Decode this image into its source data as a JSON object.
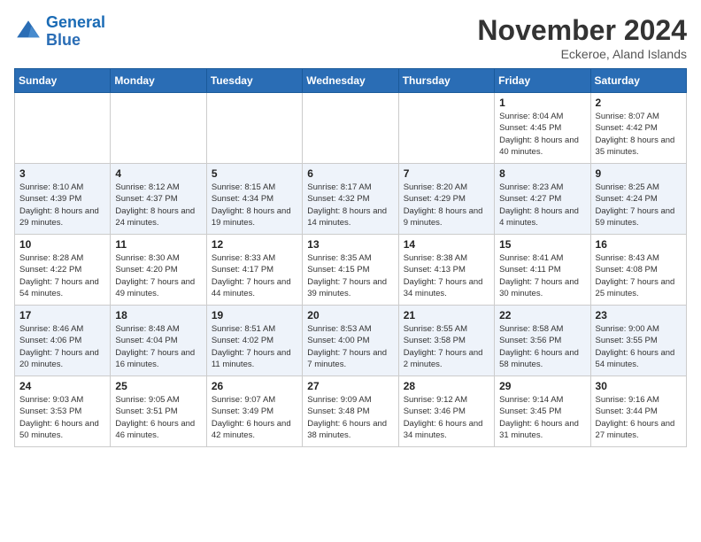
{
  "header": {
    "logo_line1": "General",
    "logo_line2": "Blue",
    "month_title": "November 2024",
    "subtitle": "Eckeroe, Aland Islands"
  },
  "weekdays": [
    "Sunday",
    "Monday",
    "Tuesday",
    "Wednesday",
    "Thursday",
    "Friday",
    "Saturday"
  ],
  "weeks": [
    [
      {
        "day": "",
        "info": ""
      },
      {
        "day": "",
        "info": ""
      },
      {
        "day": "",
        "info": ""
      },
      {
        "day": "",
        "info": ""
      },
      {
        "day": "",
        "info": ""
      },
      {
        "day": "1",
        "info": "Sunrise: 8:04 AM\nSunset: 4:45 PM\nDaylight: 8 hours and 40 minutes."
      },
      {
        "day": "2",
        "info": "Sunrise: 8:07 AM\nSunset: 4:42 PM\nDaylight: 8 hours and 35 minutes."
      }
    ],
    [
      {
        "day": "3",
        "info": "Sunrise: 8:10 AM\nSunset: 4:39 PM\nDaylight: 8 hours and 29 minutes."
      },
      {
        "day": "4",
        "info": "Sunrise: 8:12 AM\nSunset: 4:37 PM\nDaylight: 8 hours and 24 minutes."
      },
      {
        "day": "5",
        "info": "Sunrise: 8:15 AM\nSunset: 4:34 PM\nDaylight: 8 hours and 19 minutes."
      },
      {
        "day": "6",
        "info": "Sunrise: 8:17 AM\nSunset: 4:32 PM\nDaylight: 8 hours and 14 minutes."
      },
      {
        "day": "7",
        "info": "Sunrise: 8:20 AM\nSunset: 4:29 PM\nDaylight: 8 hours and 9 minutes."
      },
      {
        "day": "8",
        "info": "Sunrise: 8:23 AM\nSunset: 4:27 PM\nDaylight: 8 hours and 4 minutes."
      },
      {
        "day": "9",
        "info": "Sunrise: 8:25 AM\nSunset: 4:24 PM\nDaylight: 7 hours and 59 minutes."
      }
    ],
    [
      {
        "day": "10",
        "info": "Sunrise: 8:28 AM\nSunset: 4:22 PM\nDaylight: 7 hours and 54 minutes."
      },
      {
        "day": "11",
        "info": "Sunrise: 8:30 AM\nSunset: 4:20 PM\nDaylight: 7 hours and 49 minutes."
      },
      {
        "day": "12",
        "info": "Sunrise: 8:33 AM\nSunset: 4:17 PM\nDaylight: 7 hours and 44 minutes."
      },
      {
        "day": "13",
        "info": "Sunrise: 8:35 AM\nSunset: 4:15 PM\nDaylight: 7 hours and 39 minutes."
      },
      {
        "day": "14",
        "info": "Sunrise: 8:38 AM\nSunset: 4:13 PM\nDaylight: 7 hours and 34 minutes."
      },
      {
        "day": "15",
        "info": "Sunrise: 8:41 AM\nSunset: 4:11 PM\nDaylight: 7 hours and 30 minutes."
      },
      {
        "day": "16",
        "info": "Sunrise: 8:43 AM\nSunset: 4:08 PM\nDaylight: 7 hours and 25 minutes."
      }
    ],
    [
      {
        "day": "17",
        "info": "Sunrise: 8:46 AM\nSunset: 4:06 PM\nDaylight: 7 hours and 20 minutes."
      },
      {
        "day": "18",
        "info": "Sunrise: 8:48 AM\nSunset: 4:04 PM\nDaylight: 7 hours and 16 minutes."
      },
      {
        "day": "19",
        "info": "Sunrise: 8:51 AM\nSunset: 4:02 PM\nDaylight: 7 hours and 11 minutes."
      },
      {
        "day": "20",
        "info": "Sunrise: 8:53 AM\nSunset: 4:00 PM\nDaylight: 7 hours and 7 minutes."
      },
      {
        "day": "21",
        "info": "Sunrise: 8:55 AM\nSunset: 3:58 PM\nDaylight: 7 hours and 2 minutes."
      },
      {
        "day": "22",
        "info": "Sunrise: 8:58 AM\nSunset: 3:56 PM\nDaylight: 6 hours and 58 minutes."
      },
      {
        "day": "23",
        "info": "Sunrise: 9:00 AM\nSunset: 3:55 PM\nDaylight: 6 hours and 54 minutes."
      }
    ],
    [
      {
        "day": "24",
        "info": "Sunrise: 9:03 AM\nSunset: 3:53 PM\nDaylight: 6 hours and 50 minutes."
      },
      {
        "day": "25",
        "info": "Sunrise: 9:05 AM\nSunset: 3:51 PM\nDaylight: 6 hours and 46 minutes."
      },
      {
        "day": "26",
        "info": "Sunrise: 9:07 AM\nSunset: 3:49 PM\nDaylight: 6 hours and 42 minutes."
      },
      {
        "day": "27",
        "info": "Sunrise: 9:09 AM\nSunset: 3:48 PM\nDaylight: 6 hours and 38 minutes."
      },
      {
        "day": "28",
        "info": "Sunrise: 9:12 AM\nSunset: 3:46 PM\nDaylight: 6 hours and 34 minutes."
      },
      {
        "day": "29",
        "info": "Sunrise: 9:14 AM\nSunset: 3:45 PM\nDaylight: 6 hours and 31 minutes."
      },
      {
        "day": "30",
        "info": "Sunrise: 9:16 AM\nSunset: 3:44 PM\nDaylight: 6 hours and 27 minutes."
      }
    ]
  ]
}
